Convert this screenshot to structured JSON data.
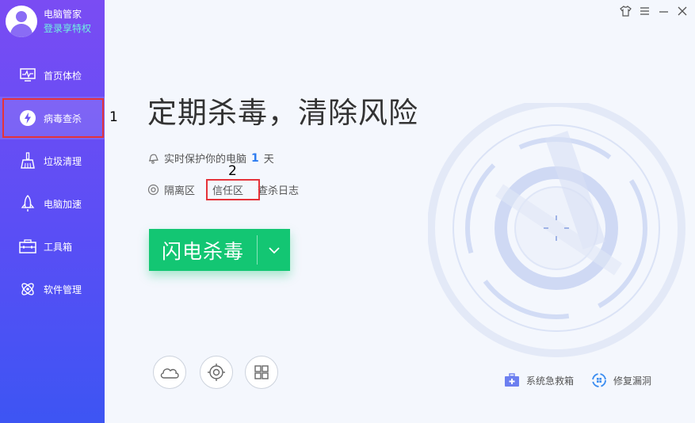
{
  "app": {
    "name": "电脑管家",
    "login": "登录享特权"
  },
  "nav": {
    "items": [
      {
        "label": "首页体检",
        "icon": "monitor-icon"
      },
      {
        "label": "病毒查杀",
        "icon": "lightning-shield-icon",
        "active": true
      },
      {
        "label": "垃圾清理",
        "icon": "broom-icon"
      },
      {
        "label": "电脑加速",
        "icon": "rocket-icon"
      },
      {
        "label": "工具箱",
        "icon": "toolbox-icon"
      },
      {
        "label": "软件管理",
        "icon": "software-icon"
      }
    ]
  },
  "annotations": {
    "one": "1",
    "two": "2"
  },
  "window": {
    "controls": [
      "skin-icon",
      "menu-icon",
      "minimize-icon",
      "close-icon"
    ]
  },
  "main": {
    "headline": "定期杀毒，清除风险",
    "protect_prefix": "实时保护你的电脑",
    "protect_days": "1",
    "protect_suffix": "天",
    "links": {
      "quarantine": "隔离区",
      "trust": "信任区",
      "log": "查杀日志"
    },
    "scan_button": "闪电杀毒"
  },
  "bottom": {
    "circles": [
      "cloud-icon",
      "target-icon",
      "windows-icon"
    ],
    "tools": [
      {
        "label": "系统急救箱",
        "icon": "firstaid-icon"
      },
      {
        "label": "修复漏洞",
        "icon": "repair-icon"
      }
    ]
  },
  "colors": {
    "accent_green": "#13c673",
    "sidebar_top": "#7a4cf3",
    "sidebar_bottom": "#3d55f3",
    "highlight_red": "#e5333a",
    "link_blue": "#2d7cf0"
  }
}
